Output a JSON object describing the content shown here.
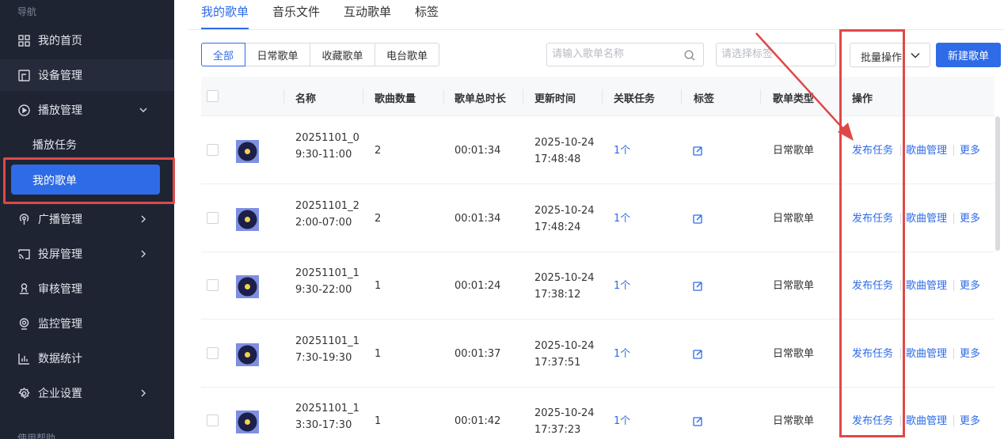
{
  "sidebar": {
    "header": "导航",
    "footer": "使用帮助",
    "items": [
      {
        "label": "我的首页",
        "icon": "dashboard-grid-icon"
      },
      {
        "label": "设备管理",
        "icon": "device-icon"
      },
      {
        "label": "播放管理",
        "icon": "play-circle-icon"
      },
      {
        "label": "播放任务"
      },
      {
        "label": "我的歌单"
      },
      {
        "label": "广播管理",
        "icon": "broadcast-icon"
      },
      {
        "label": "投屏管理",
        "icon": "cast-icon"
      },
      {
        "label": "审核管理",
        "icon": "audit-icon"
      },
      {
        "label": "监控管理",
        "icon": "monitor-icon"
      },
      {
        "label": "数据统计",
        "icon": "bar-chart-icon"
      },
      {
        "label": "企业设置",
        "icon": "gear-icon"
      }
    ]
  },
  "tabs": [
    "我的歌单",
    "音乐文件",
    "互动歌单",
    "标签"
  ],
  "filters": [
    "全部",
    "日常歌单",
    "收藏歌单",
    "电台歌单"
  ],
  "search": {
    "placeholder": "请输入歌单名称"
  },
  "tag_select": {
    "placeholder": "请选择标签"
  },
  "batch_label": "批量操作",
  "new_label": "新建歌单",
  "columns": [
    "名称",
    "歌曲数量",
    "歌单总时长",
    "更新时间",
    "关联任务",
    "标签",
    "歌单类型",
    "操作"
  ],
  "rows": [
    {
      "name1": "20251101_0",
      "name2": "9:30-11:00",
      "count": "2",
      "duration": "00:01:34",
      "date": "2025-10-24",
      "time": "17:48:48",
      "tasks": "1个",
      "type": "日常歌单"
    },
    {
      "name1": "20251101_2",
      "name2": "2:00-07:00",
      "count": "2",
      "duration": "00:01:34",
      "date": "2025-10-24",
      "time": "17:48:24",
      "tasks": "1个",
      "type": "日常歌单"
    },
    {
      "name1": "20251101_1",
      "name2": "9:30-22:00",
      "count": "1",
      "duration": "00:01:24",
      "date": "2025-10-24",
      "time": "17:38:12",
      "tasks": "1个",
      "type": "日常歌单"
    },
    {
      "name1": "20251101_1",
      "name2": "7:30-19:30",
      "count": "1",
      "duration": "00:01:37",
      "date": "2025-10-24",
      "time": "17:37:51",
      "tasks": "1个",
      "type": "日常歌单"
    },
    {
      "name1": "20251101_1",
      "name2": "3:30-17:30",
      "count": "1",
      "duration": "00:01:42",
      "date": "2025-10-24",
      "time": "17:37:23",
      "tasks": "1个",
      "type": "日常歌单"
    }
  ],
  "ops": {
    "publish": "发布任务",
    "manage": "歌曲管理",
    "more": "更多"
  },
  "colors": {
    "primary": "#2e6be6",
    "sidebar_bg": "#1f2433",
    "annotation_red": "#e04848"
  }
}
